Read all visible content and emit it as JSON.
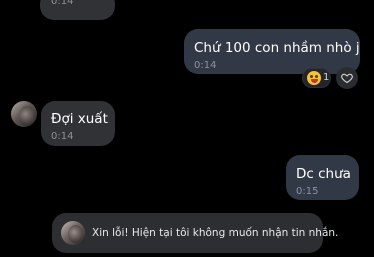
{
  "messages": [
    {
      "direction": "incoming",
      "text": "",
      "time": "0:14"
    },
    {
      "direction": "outgoing",
      "text": "Chứ 100 con nhầm nhò j",
      "time": "0:14"
    },
    {
      "direction": "incoming",
      "text": "Đợi xuất",
      "time": "0:14"
    },
    {
      "direction": "outgoing",
      "text": "Dc chưa",
      "time": "0:15"
    }
  ],
  "reaction": {
    "icon": "laughing-emoji-icon",
    "count": "1"
  },
  "heart_icon": "heart-icon",
  "notice": {
    "text": "Xin lỗi! Hiện tại tôi không muốn nhận tin nhắn."
  },
  "colors": {
    "background": "#000000",
    "incoming_bubble": "#303236",
    "outgoing_bubble": "#323946",
    "timestamp": "#8d8f94"
  }
}
